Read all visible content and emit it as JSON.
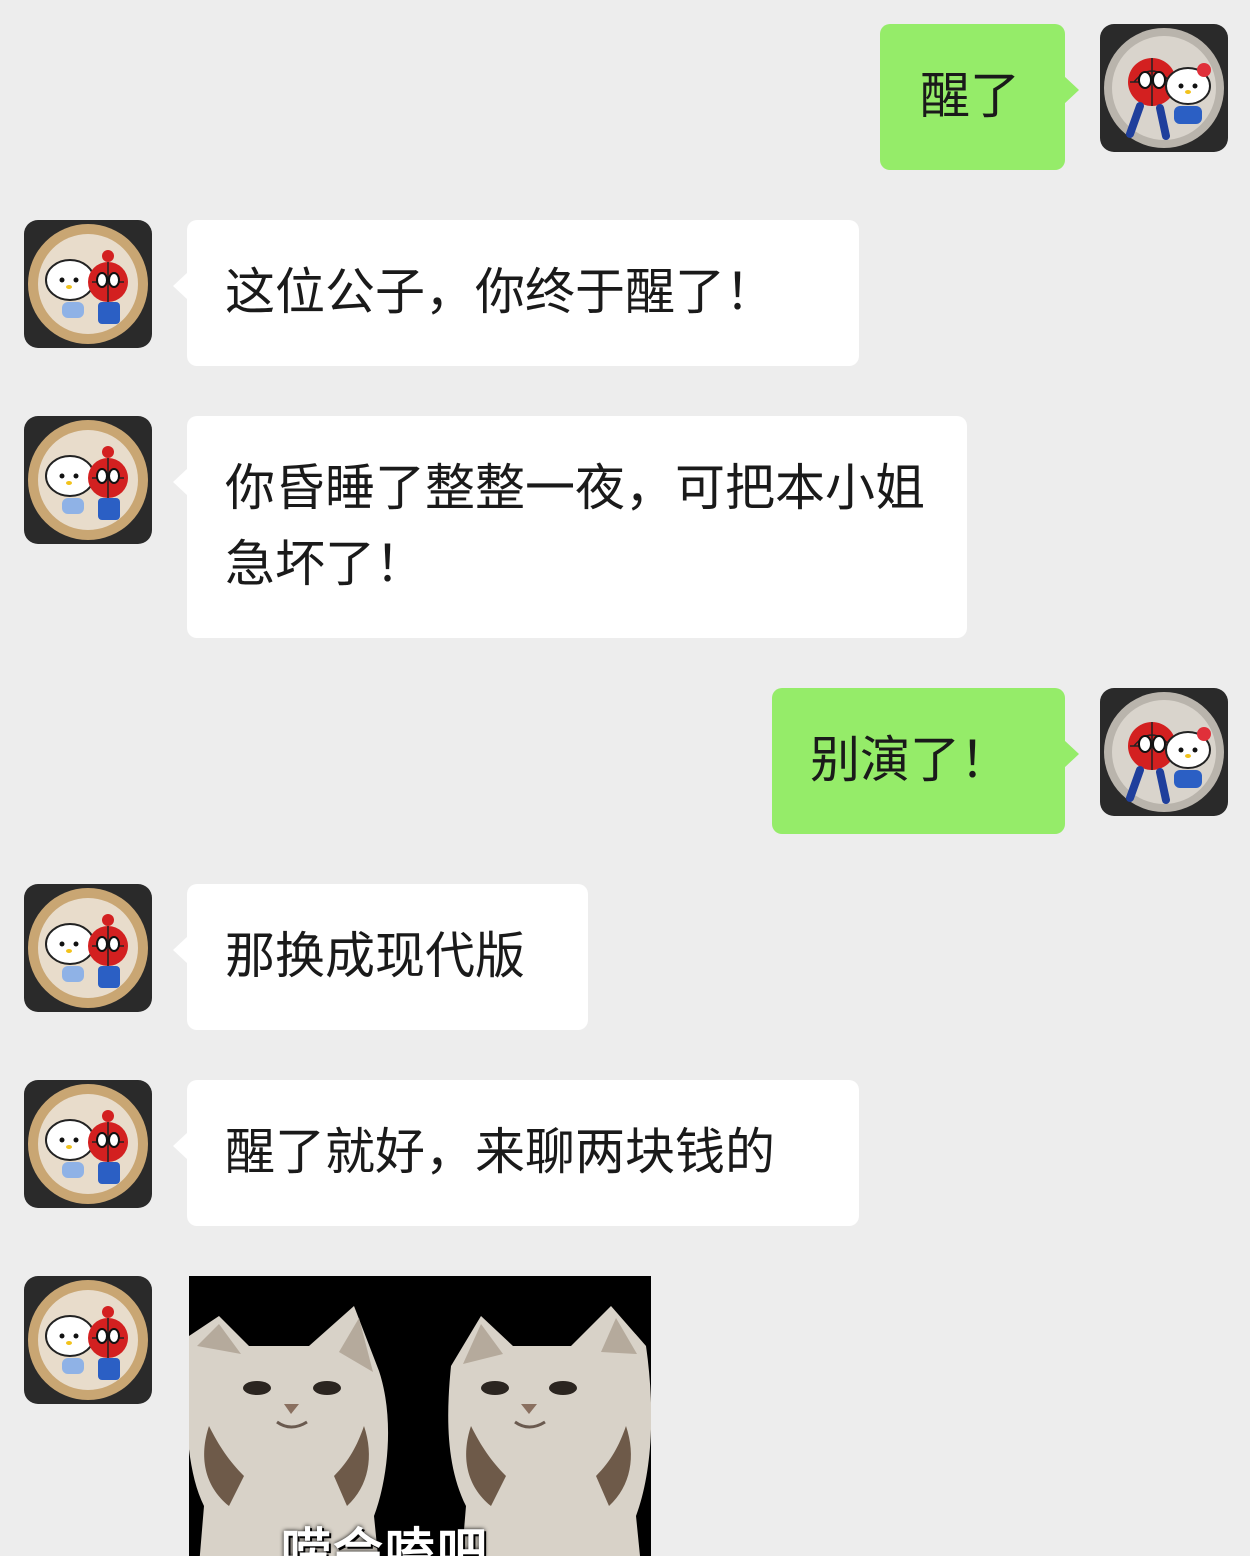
{
  "messages": [
    {
      "sender": "me",
      "text": "醒了"
    },
    {
      "sender": "friend",
      "text": "这位公子，你终于醒了！"
    },
    {
      "sender": "friend",
      "text": "你昏睡了整整一夜，可把本小姐急坏了！"
    },
    {
      "sender": "me",
      "text": "别演了！"
    },
    {
      "sender": "friend",
      "text": "那换成现代版"
    },
    {
      "sender": "friend",
      "text": "醒了就好，来聊两块钱的"
    },
    {
      "sender": "friend",
      "type": "sticker",
      "caption": "唠会嗑吧"
    }
  ],
  "avatars": {
    "me": "spiderman-hello-kitty-avatar",
    "friend": "hello-kitty-spiderman-avatar"
  },
  "colors": {
    "background": "#ededed",
    "outgoing_bubble": "#95ec69",
    "incoming_bubble": "#ffffff"
  }
}
